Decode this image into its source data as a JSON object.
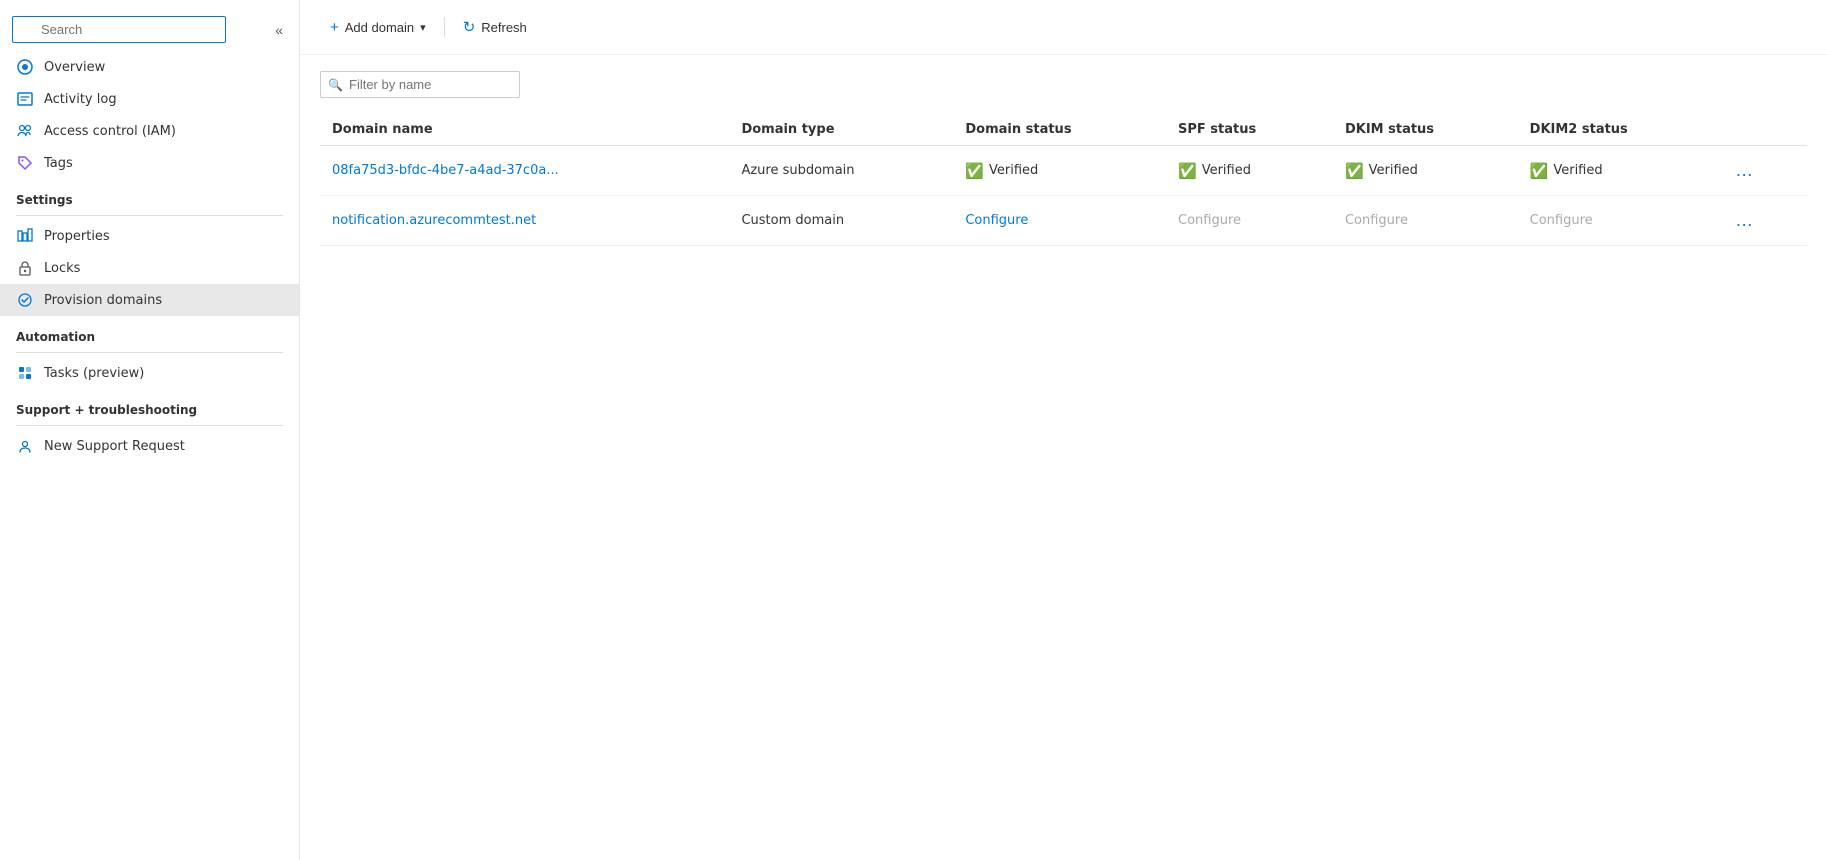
{
  "sidebar": {
    "search_placeholder": "Search",
    "nav_items": [
      {
        "id": "overview",
        "label": "Overview",
        "icon": "overview-icon",
        "active": false
      },
      {
        "id": "activity-log",
        "label": "Activity log",
        "icon": "activity-icon",
        "active": false
      },
      {
        "id": "iam",
        "label": "Access control (IAM)",
        "icon": "iam-icon",
        "active": false
      },
      {
        "id": "tags",
        "label": "Tags",
        "icon": "tags-icon",
        "active": false
      }
    ],
    "settings_label": "Settings",
    "settings_items": [
      {
        "id": "properties",
        "label": "Properties",
        "icon": "properties-icon",
        "active": false
      },
      {
        "id": "locks",
        "label": "Locks",
        "icon": "locks-icon",
        "active": false
      },
      {
        "id": "provision-domains",
        "label": "Provision domains",
        "icon": "provision-icon",
        "active": true
      }
    ],
    "automation_label": "Automation",
    "automation_items": [
      {
        "id": "tasks",
        "label": "Tasks (preview)",
        "icon": "tasks-icon",
        "active": false
      }
    ],
    "support_label": "Support + troubleshooting",
    "support_items": [
      {
        "id": "new-support",
        "label": "New Support Request",
        "icon": "support-icon",
        "active": false
      }
    ]
  },
  "toolbar": {
    "add_domain_label": "Add domain",
    "refresh_label": "Refresh"
  },
  "filter": {
    "placeholder": "Filter by name"
  },
  "table": {
    "columns": [
      "Domain name",
      "Domain type",
      "Domain status",
      "SPF status",
      "DKIM status",
      "DKIM2 status"
    ],
    "rows": [
      {
        "domain_name": "08fa75d3-bfdc-4be7-a4ad-37c0a...",
        "domain_type": "Azure subdomain",
        "domain_status": "Verified",
        "domain_status_type": "verified",
        "spf_status": "Verified",
        "spf_status_type": "verified",
        "dkim_status": "Verified",
        "dkim_status_type": "verified",
        "dkim2_status": "Verified",
        "dkim2_status_type": "verified"
      },
      {
        "domain_name": "notification.azurecommtest.net",
        "domain_type": "Custom domain",
        "domain_status": "Configure",
        "domain_status_type": "configure",
        "spf_status": "Configure",
        "spf_status_type": "configure-gray",
        "dkim_status": "Configure",
        "dkim_status_type": "configure-gray",
        "dkim2_status": "Configure",
        "dkim2_status_type": "configure-gray"
      }
    ]
  }
}
